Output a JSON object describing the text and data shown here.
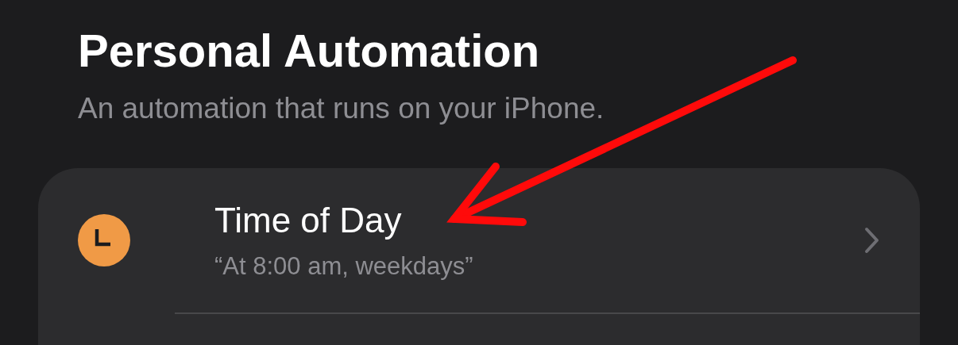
{
  "title": "Personal Automation",
  "subtitle": "An automation that runs on your iPhone.",
  "triggers": [
    {
      "title": "Time of Day",
      "detail": "“At 8:00 am, weekdays”"
    }
  ]
}
